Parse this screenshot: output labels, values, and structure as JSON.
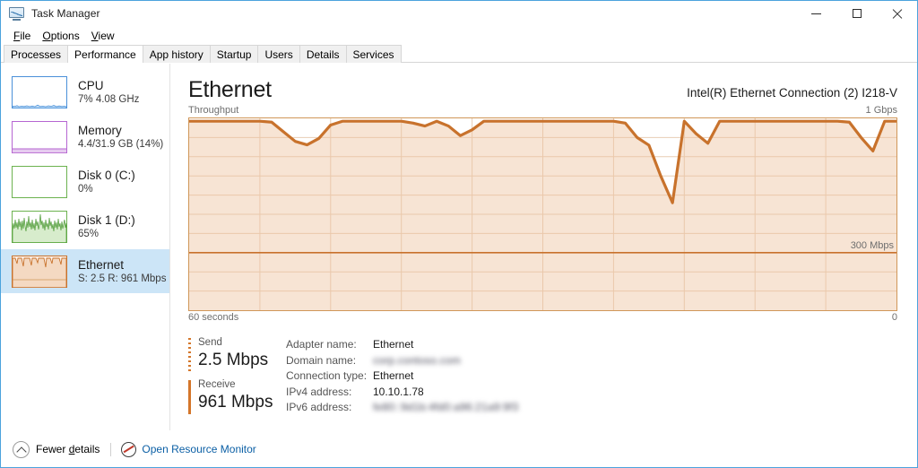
{
  "window": {
    "title": "Task Manager",
    "icon": "task-manager-icon",
    "controls": {
      "minimize": "–",
      "maximize": "□",
      "close": "✕"
    }
  },
  "menu": {
    "items": [
      {
        "label": "File",
        "accel": "F"
      },
      {
        "label": "Options",
        "accel": "O"
      },
      {
        "label": "View",
        "accel": "V"
      }
    ]
  },
  "tabs": {
    "active": "Performance",
    "items": [
      {
        "label": "Processes"
      },
      {
        "label": "Performance"
      },
      {
        "label": "App history"
      },
      {
        "label": "Startup"
      },
      {
        "label": "Users"
      },
      {
        "label": "Details"
      },
      {
        "label": "Services"
      }
    ]
  },
  "sidebar": {
    "items": [
      {
        "id": "cpu",
        "title": "CPU",
        "subtitle": "7% 4.08 GHz",
        "color": "#4a90d9",
        "fill": "rgba(116,178,232,0.35)",
        "selected": false
      },
      {
        "id": "memory",
        "title": "Memory",
        "subtitle": "4.4/31.9 GB (14%)",
        "color": "#b666d2",
        "fill": "rgba(200,140,220,0.38)",
        "selected": false
      },
      {
        "id": "disk0",
        "title": "Disk 0 (C:)",
        "subtitle": "0%",
        "color": "#6cb24f",
        "fill": "rgba(140,200,110,0.30)",
        "selected": false
      },
      {
        "id": "disk1",
        "title": "Disk 1 (D:)",
        "subtitle": "65%",
        "color": "#4e9b36",
        "fill": "rgba(140,200,110,0.30)",
        "selected": false
      },
      {
        "id": "ethernet",
        "title": "Ethernet",
        "subtitle": "S: 2.5 R: 961 Mbps",
        "color": "#d4762a",
        "fill": "rgba(237,195,160,0.45)",
        "selected": true
      }
    ]
  },
  "main": {
    "title": "Ethernet",
    "subtitle": "Intel(R) Ethernet Connection (2) I218-V",
    "graph_label": "Throughput",
    "y_max_label": "1 Gbps",
    "y_mid_label": "300 Mbps",
    "x_left_label": "60 seconds",
    "x_right_label": "0"
  },
  "stats": {
    "send": {
      "label": "Send",
      "value": "2.5 Mbps",
      "marker": "dotted",
      "color": "#d4762a"
    },
    "receive": {
      "label": "Receive",
      "value": "961 Mbps",
      "marker": "solid",
      "color": "#d4762a"
    },
    "info": [
      {
        "key": "Adapter name:",
        "value": "Ethernet",
        "redacted": false
      },
      {
        "key": "Domain name:",
        "value": "corp.contoso.com",
        "redacted": true
      },
      {
        "key": "Connection type:",
        "value": "Ethernet",
        "redacted": false
      },
      {
        "key": "IPv4 address:",
        "value": "10.10.1.78",
        "redacted": false
      },
      {
        "key": "IPv6 address:",
        "value": "fe80::9d1b:4fd0:a96:21a9:9f3",
        "redacted": true
      }
    ]
  },
  "footer": {
    "fewer_details": {
      "label": "Fewer details",
      "accel": "d",
      "icon": "chevron-up-circle-icon"
    },
    "resource_monitor": {
      "label": "Open Resource Monitor",
      "icon": "resource-monitor-icon"
    }
  },
  "chart_data": {
    "type": "area",
    "title": "Throughput",
    "xlabel": "60 seconds",
    "ylabel": "Throughput",
    "ylim": [
      0,
      1000
    ],
    "y_unit": "Mbps",
    "y_max_label": "1 Gbps",
    "y_mid_label": "300 Mbps",
    "y_mid_value": 300,
    "x_left_label": "60 seconds",
    "x_right_label": "0",
    "grid": true,
    "grid_cols": 10,
    "grid_rows": 10,
    "legend": "none",
    "line_color": "#c8722c",
    "fill_color": "rgba(237,195,160,0.45)",
    "series": [
      {
        "name": "Receive throughput",
        "x": [
          0,
          1,
          2,
          3,
          4,
          5,
          6,
          7,
          8,
          9,
          10,
          11,
          12,
          13,
          14,
          15,
          16,
          17,
          18,
          19,
          20,
          21,
          22,
          23,
          24,
          25,
          26,
          27,
          28,
          29,
          30,
          31,
          32,
          33,
          34,
          35,
          36,
          37,
          38,
          39,
          40,
          41,
          42,
          43,
          44,
          45,
          46,
          47,
          48,
          49,
          50,
          51,
          52,
          53,
          54,
          55,
          56,
          57,
          58,
          59,
          60
        ],
        "values": [
          985,
          985,
          985,
          985,
          985,
          985,
          985,
          980,
          930,
          880,
          862,
          895,
          965,
          985,
          985,
          985,
          985,
          985,
          985,
          975,
          960,
          985,
          960,
          910,
          940,
          985,
          985,
          985,
          985,
          985,
          985,
          985,
          985,
          985,
          985,
          985,
          985,
          975,
          900,
          860,
          700,
          560,
          985,
          920,
          870,
          985,
          985,
          985,
          985,
          985,
          985,
          985,
          985,
          985,
          985,
          985,
          980,
          900,
          830,
          985,
          985
        ]
      }
    ],
    "dips": [
      {
        "x": 10,
        "value": 862
      },
      {
        "x": 23,
        "value": 910
      },
      {
        "x": 41,
        "value": 560
      },
      {
        "x": 44,
        "value": 870
      },
      {
        "x": 58,
        "value": 830
      }
    ]
  }
}
